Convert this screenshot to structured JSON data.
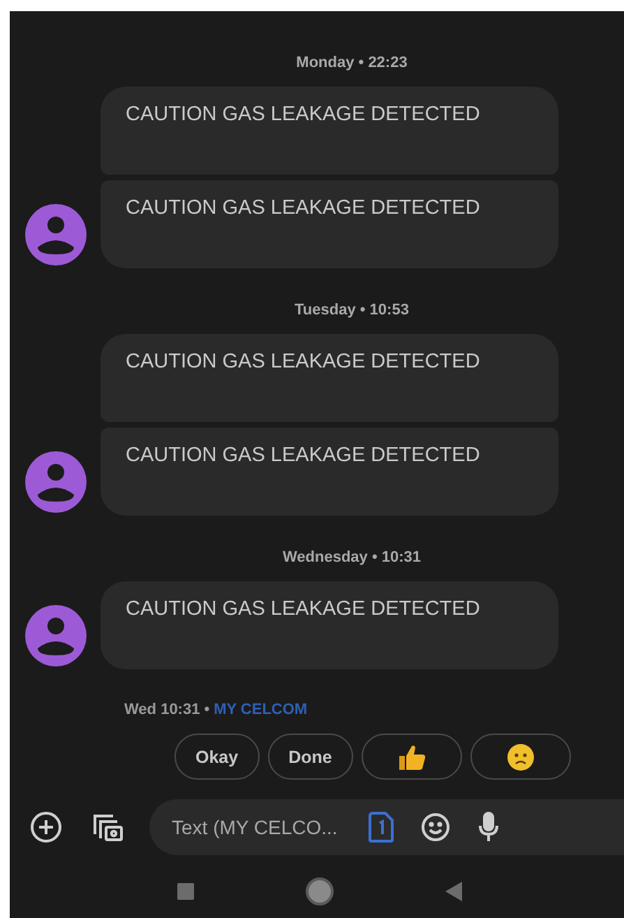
{
  "groups": [
    {
      "day_label": "Monday • 22:23",
      "messages": [
        {
          "text": "CAUTION GAS LEAKAGE DETECTED"
        },
        {
          "text": "CAUTION GAS LEAKAGE DETECTED"
        }
      ]
    },
    {
      "day_label": "Tuesday • 10:53",
      "messages": [
        {
          "text": "CAUTION GAS LEAKAGE DETECTED"
        },
        {
          "text": "CAUTION GAS LEAKAGE DETECTED"
        }
      ]
    },
    {
      "day_label": "Wednesday • 10:31",
      "messages": [
        {
          "text": "CAUTION GAS LEAKAGE DETECTED"
        }
      ]
    }
  ],
  "last_meta": {
    "time": "Wed 10:31",
    "separator": "•",
    "sender": "MY CELCOM"
  },
  "suggestions": [
    {
      "kind": "text",
      "label": "Okay"
    },
    {
      "kind": "text",
      "label": "Done"
    },
    {
      "kind": "thumbs_up"
    },
    {
      "kind": "worried_face"
    }
  ],
  "compose": {
    "placeholder": "Text (MY CELCO..."
  }
}
